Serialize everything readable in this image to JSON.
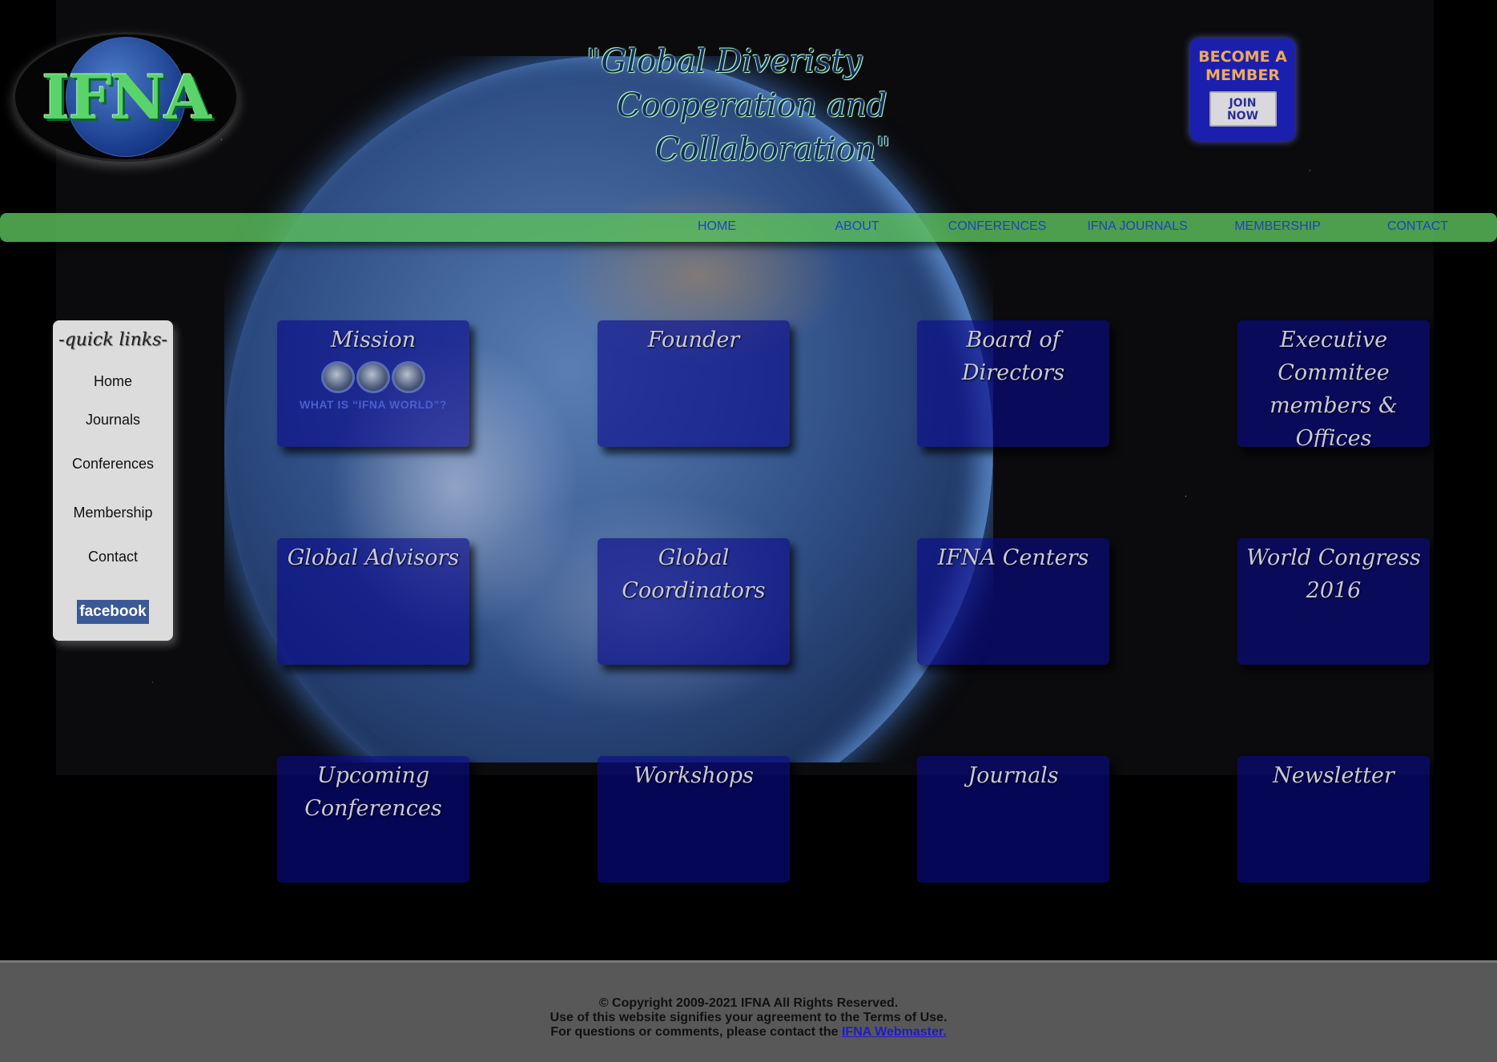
{
  "logo": {
    "text": "IFNA"
  },
  "tagline": {
    "line1": "\"Global Diveristy",
    "line2": "Cooperation and",
    "line3": "Collaboration\""
  },
  "member_badge": {
    "title_line1": "BECOME A",
    "title_line2": "MEMBER",
    "button_line1": "JOIN",
    "button_line2": "NOW"
  },
  "nav": {
    "items": [
      "HOME",
      "ABOUT",
      "CONFERENCES",
      "IFNA JOURNALS",
      "MEMBERSHIP",
      "CONTACT"
    ]
  },
  "quick_links": {
    "title": "-quick links-",
    "items": [
      "Home",
      "Journals",
      "Conferences",
      "Membership",
      "Contact"
    ],
    "facebook": "facebook"
  },
  "tiles": [
    {
      "title": "Mission",
      "caption": "WHAT IS “IFNA WORLD”?"
    },
    {
      "title": "Founder"
    },
    {
      "title": "Board of Directors"
    },
    {
      "title": "Executive Commitee members & Offices"
    },
    {
      "title": "Global Advisors"
    },
    {
      "title": "Global Coordinators"
    },
    {
      "title": "IFNA Centers"
    },
    {
      "title": "World Congress 2016"
    },
    {
      "title": "Upcoming Conferences"
    },
    {
      "title": "Workshops"
    },
    {
      "title": "Journals"
    },
    {
      "title": "Newsletter"
    }
  ],
  "footer": {
    "line1": "© Copyright 2009-2021 IFNA All Rights Reserved.",
    "line2": "Use of this website signifies your agreement to the Terms of Use.",
    "line3_prefix": "For questions or comments, please contact the",
    "link": "IFNA Webmaster."
  }
}
